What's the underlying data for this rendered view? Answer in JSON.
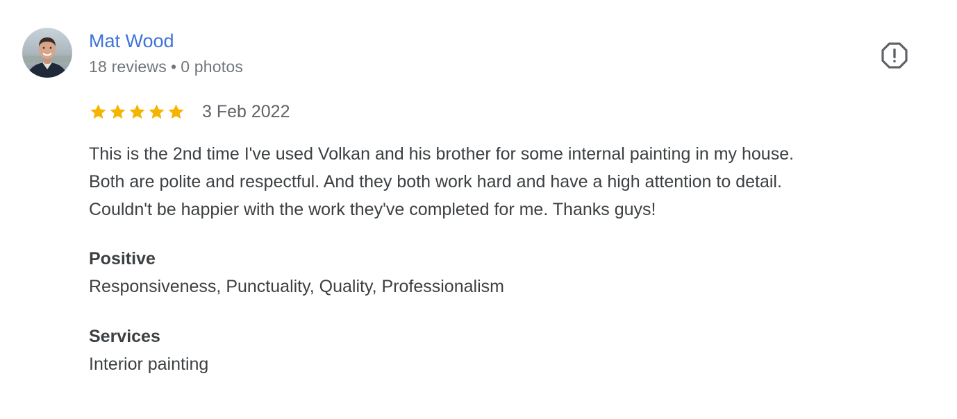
{
  "review": {
    "author": {
      "name": "Mat Wood",
      "reviews_count": "18 reviews",
      "separator": "•",
      "photos_count": "0 photos",
      "avatar_icon": "user-avatar-photo"
    },
    "report_icon": "flag-report-icon",
    "rating": {
      "stars": 5,
      "max": 5,
      "star_color": "#f4b400"
    },
    "date": "3 Feb 2022",
    "text_lines": [
      "This is the 2nd time I've used Volkan and his brother for some internal painting in my house.",
      "Both are polite and respectful. And they both work hard and have a high attention to detail.",
      "Couldn't be happier with the work they've completed for me. Thanks guys!"
    ],
    "attributes": [
      {
        "label": "Positive",
        "value": "Responsiveness, Punctuality, Quality, Professionalism"
      },
      {
        "label": "Services",
        "value": "Interior painting"
      }
    ]
  },
  "colors": {
    "author_link": "#3f73d9",
    "meta_text": "#70757a",
    "body_text": "#3c4043",
    "star": "#f4b400"
  }
}
